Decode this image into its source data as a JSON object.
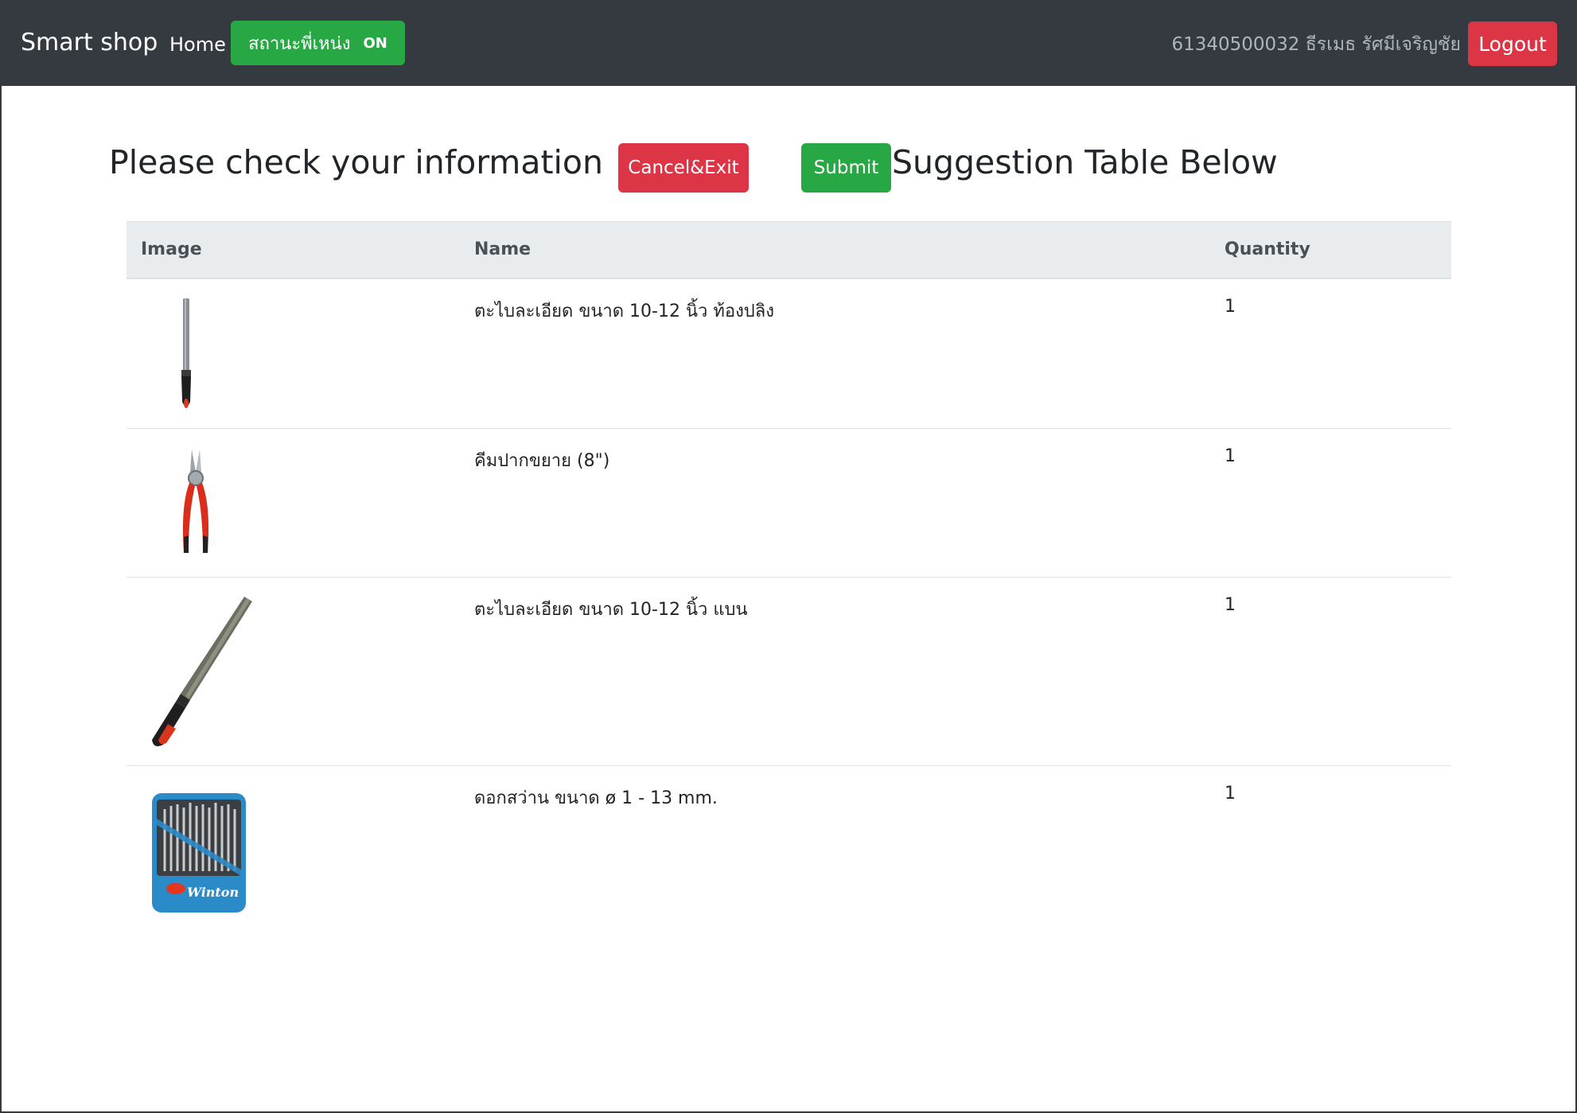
{
  "navbar": {
    "brand": "Smart shop",
    "home": "Home",
    "location_label": "สถานะพี่เหน่ง",
    "location_state": "ON",
    "user": "61340500032 ธีรเมธ รัศมีเจริญชัย",
    "logout": "Logout"
  },
  "header": {
    "title_left": "Please check your information",
    "cancel_label": "Cancel&Exit",
    "submit_label": "Submit",
    "title_right": "Suggestion Table Below"
  },
  "table": {
    "columns": [
      "Image",
      "Name",
      "Quantity"
    ],
    "rows": [
      {
        "icon": "round-file-icon",
        "name": "ตะไบละเอียด ขนาด 10-12 นิ้ว ท้องปลิง",
        "qty": "1"
      },
      {
        "icon": "pliers-icon",
        "name": "คีมปากขยาย (8\")",
        "qty": "1"
      },
      {
        "icon": "flat-file-icon",
        "name": "ตะไบละเอียด ขนาด 10-12 นิ้ว แบน",
        "qty": "1"
      },
      {
        "icon": "drill-bit-set-icon",
        "name": "ดอกสว่าน ขนาด ø 1 - 13 mm.",
        "qty": "1",
        "brand_text": "Winton"
      }
    ]
  },
  "colors": {
    "navbar": "#343a40",
    "success": "#28a745",
    "danger": "#dc3545",
    "table_head": "#e9ecef"
  }
}
